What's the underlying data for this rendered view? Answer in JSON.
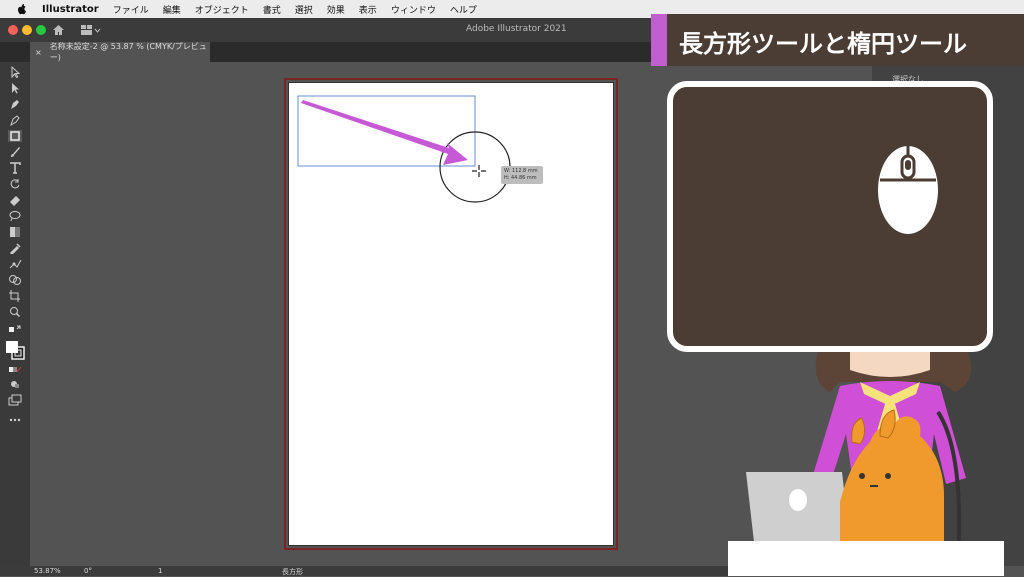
{
  "menubar": {
    "app_name": "Illustrator",
    "items": [
      "ファイル",
      "編集",
      "オブジェクト",
      "書式",
      "選択",
      "効果",
      "表示",
      "ウィンドウ",
      "ヘルプ"
    ]
  },
  "window": {
    "title": "Adobe Illustrator 2021"
  },
  "document_tab": {
    "close": "×",
    "label": "名称未設定-2 @ 53.87 % (CMYK/プレビュー)"
  },
  "measure_tooltip": {
    "width": "W: 112.8 mm",
    "height": "H: 44.86 mm"
  },
  "statusbar": {
    "zoom": "53.87%",
    "rotation": "0°",
    "page": "1",
    "tool": "長方形"
  },
  "right_panel": {
    "label": "選択なし"
  },
  "overlay": {
    "title": "長方形ツールと楕円ツール"
  },
  "colors": {
    "accent": "#c25fd0",
    "banner_bg": "#4b3c34",
    "artboard_border": "#7b2424",
    "arrow": "#c65ad6"
  }
}
